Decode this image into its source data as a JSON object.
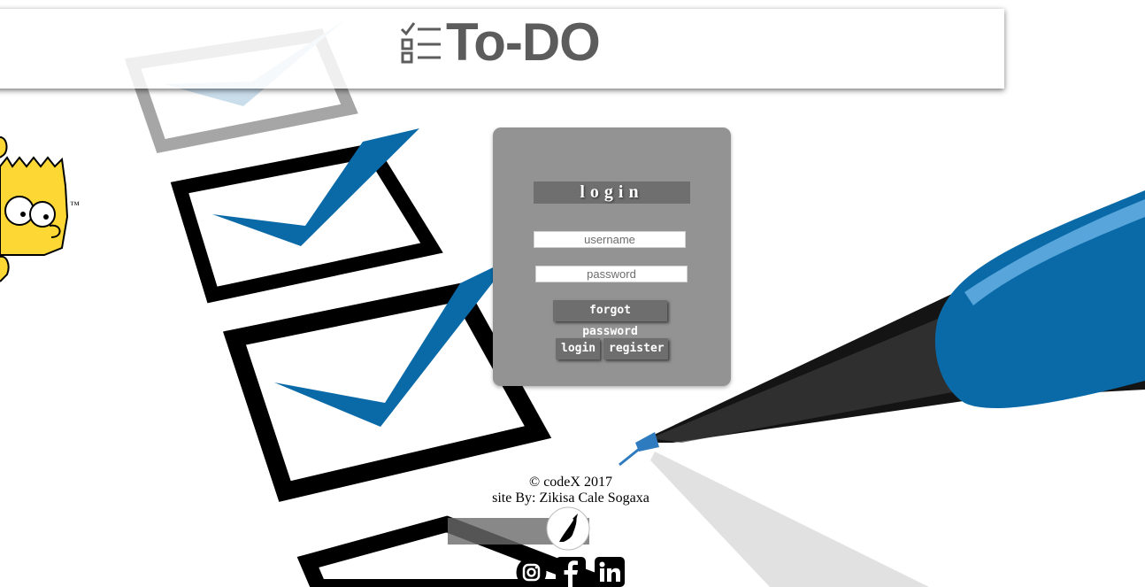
{
  "header": {
    "title": "To-DO",
    "logo_icon": "checklist-icon"
  },
  "mascot": {
    "trademark": "™"
  },
  "login": {
    "heading": "login",
    "username_placeholder": "username",
    "password_placeholder": "password",
    "forgot_label": "forgot password",
    "login_label": "login",
    "register_label": "register"
  },
  "footer": {
    "copyright": "© codeX 2017",
    "credit": "site By: Zikisa Cale Sogaxa"
  },
  "social": {
    "instagram_icon": "instagram-icon",
    "facebook_icon": "facebook-icon",
    "linkedin_icon": "linkedin-icon"
  },
  "colors": {
    "panel": "#939393",
    "button": "#6e6e6e",
    "accent_blue": "#0a6aa8",
    "title": "#5c5c5c"
  }
}
